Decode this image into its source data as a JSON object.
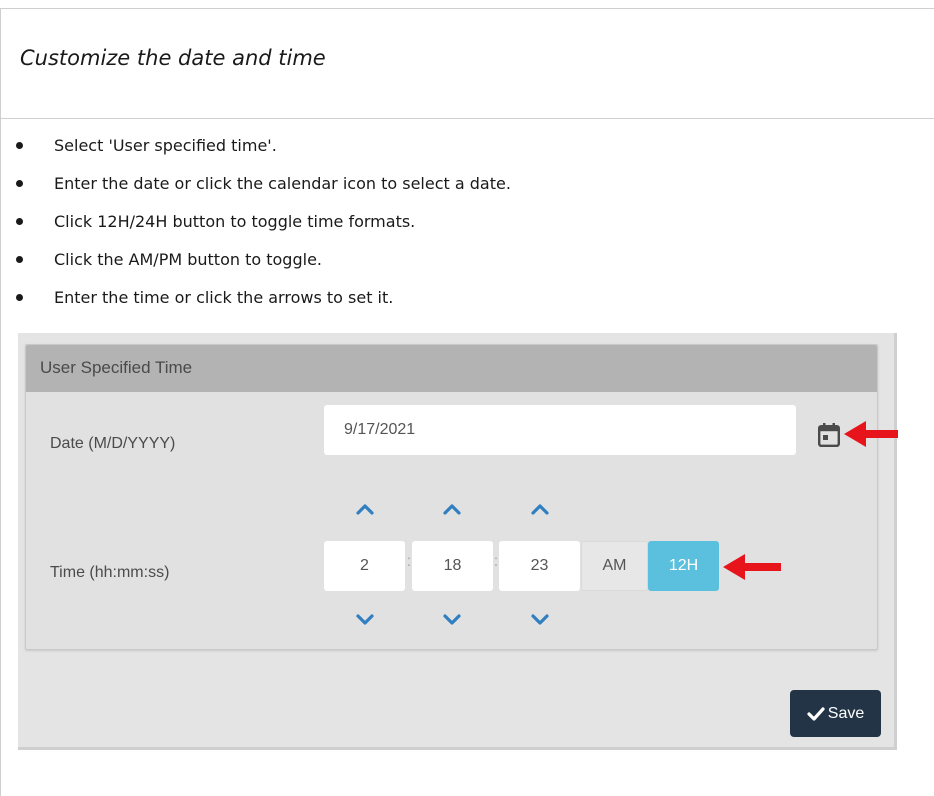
{
  "heading": "Customize the date and time",
  "instructions": [
    "Select 'User specified time'.",
    "Enter the date or click the calendar icon to select a date.",
    "Click 12H/24H button to toggle time formats.",
    "Click the AM/PM button to toggle.",
    "Enter the time or click the arrows to set it."
  ],
  "panel": {
    "title": "User Specified Time",
    "date_label": "Date (M/D/YYYY)",
    "date_value": "9/17/2021",
    "time_label": "Time (hh:mm:ss)",
    "hours": "2",
    "minutes": "18",
    "seconds": "23",
    "separator": ":",
    "ampm_label": "AM",
    "format_label": "12H",
    "save_label": "Save"
  },
  "icons": {
    "calendar": "calendar-icon",
    "chevron_up": "chevron-up-icon",
    "chevron_down": "chevron-down-icon",
    "arrow": "red-arrow-icon",
    "check": "check-icon"
  },
  "colors": {
    "accent_blue": "#5bc0de",
    "chevron_blue": "#2f7fc1",
    "arrow_red": "#e8141b",
    "save_button": "#243447",
    "panel_header": "#b3b3b3"
  }
}
